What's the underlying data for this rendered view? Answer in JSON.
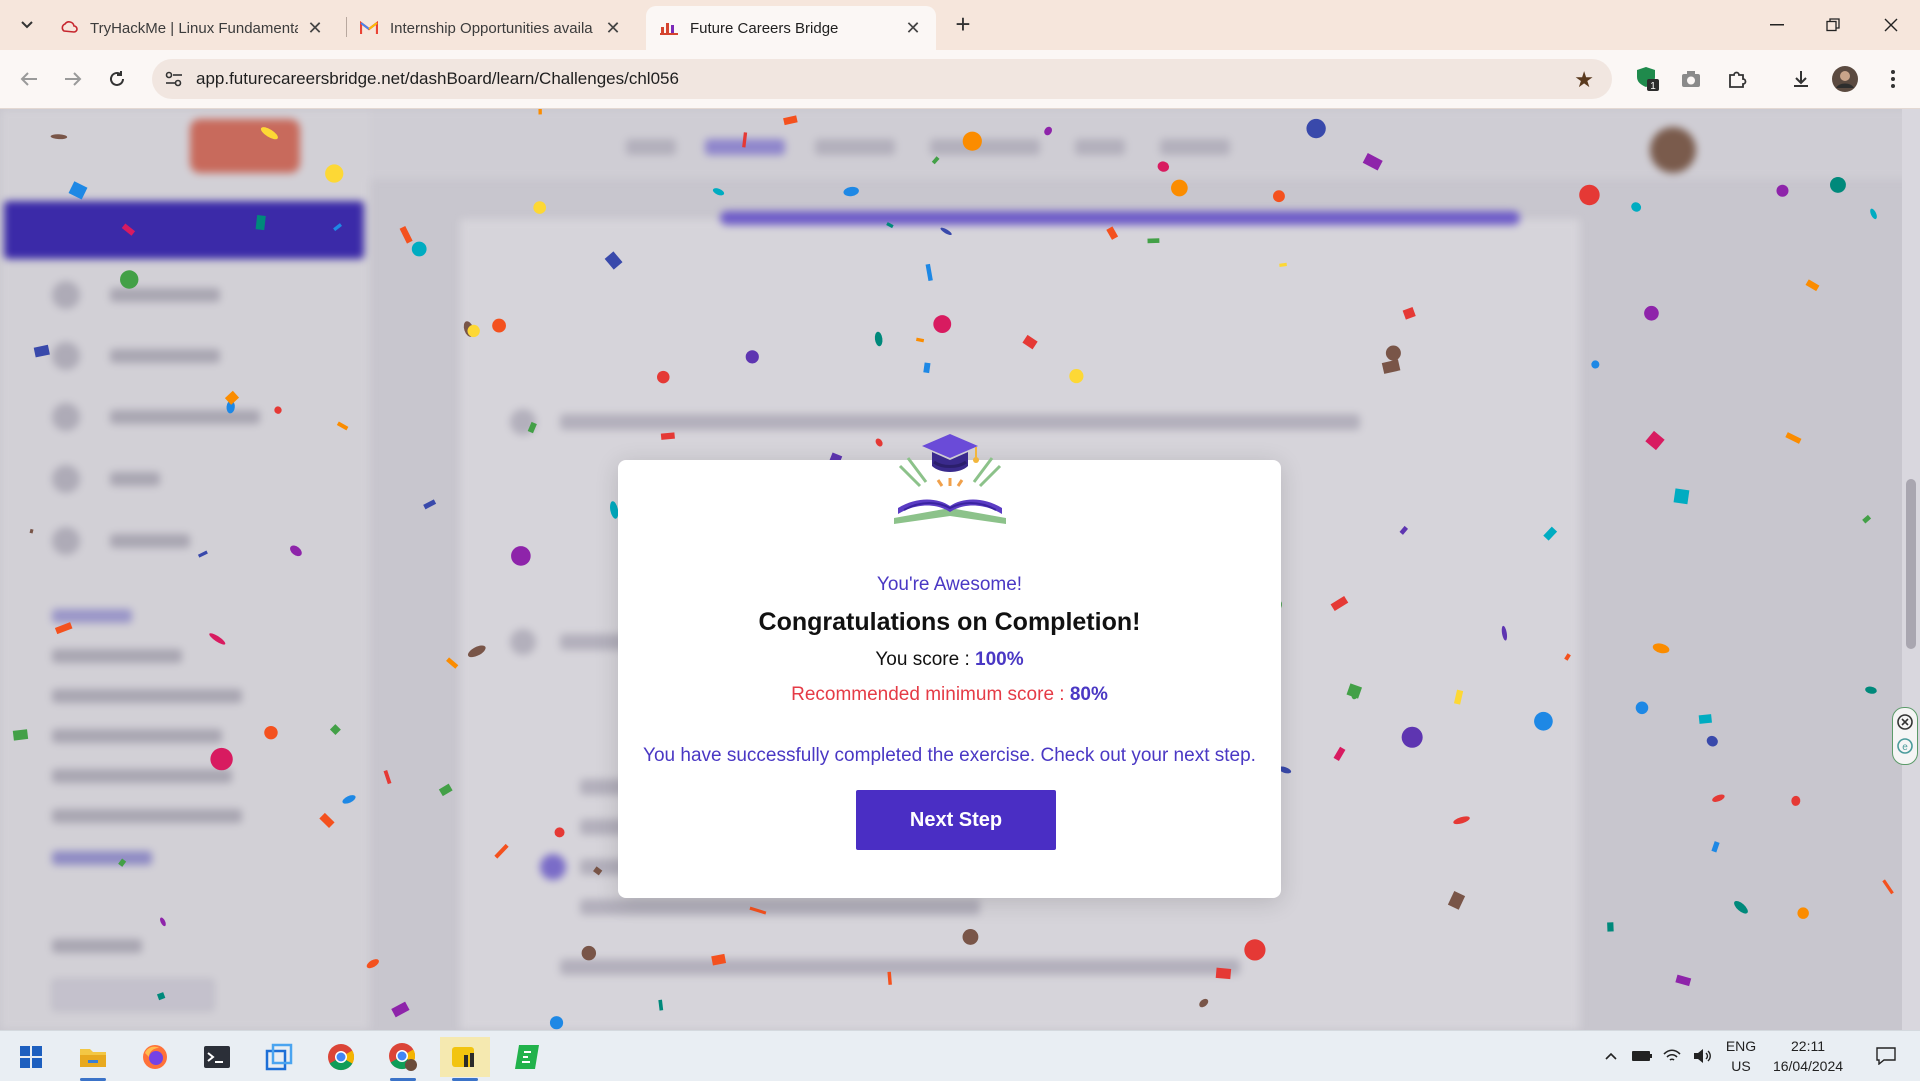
{
  "browser": {
    "tabs": [
      {
        "title": "TryHackMe | Linux Fundamenta",
        "favicon": "tryhackme-icon"
      },
      {
        "title": "Internship Opportunities availa",
        "favicon": "gmail-icon"
      },
      {
        "title": "Future Careers Bridge",
        "favicon": "fcb-icon",
        "active": true
      }
    ],
    "url": "app.futurecareersbridge.net/dashBoard/learn/Challenges/chl056",
    "extension_badge": "1"
  },
  "modal": {
    "awesome": "You're Awesome!",
    "title": "Congratulations on Completion!",
    "score_label": "You score : ",
    "score_value": "100%",
    "min_label": "Recommended minimum score : ",
    "min_value": "80%",
    "message": "You have successfully completed the exercise. Check out your next step.",
    "button": "Next Step"
  },
  "taskbar": {
    "apps": [
      "windows-start-icon",
      "file-explorer-icon",
      "firefox-icon",
      "terminal-icon",
      "vm-icon",
      "chrome-icon",
      "chrome-profile-icon",
      "notes-app-icon",
      "green-app-icon"
    ],
    "lang": "ENG",
    "region": "US",
    "time": "22:11",
    "date": "16/04/2024"
  },
  "colors": {
    "accent": "#4a2ec4",
    "text_accent": "#4a38c4",
    "warning": "#e53b46",
    "tab_strip": "#f6e6dc"
  }
}
